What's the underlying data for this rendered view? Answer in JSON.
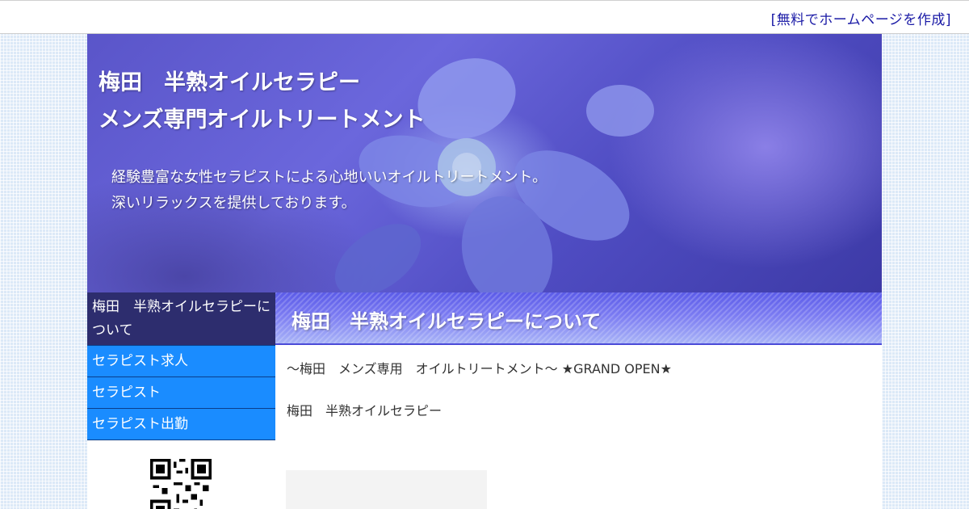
{
  "topbar": {
    "create_link": "[無料でホームページを作成]"
  },
  "header": {
    "title_line1": "梅田　半熟オイルセラピー",
    "title_line2": "メンズ専門オイルトリートメント",
    "desc_line1": "経験豊富な女性セラピストによる心地いいオイルトリートメント。",
    "desc_line2": "深いリラックスを提供しております。"
  },
  "sidebar": {
    "items": [
      {
        "label": "梅田　半熟オイルセラピーについて"
      },
      {
        "label": "セラピスト求人"
      },
      {
        "label": "セラピスト"
      },
      {
        "label": "セラピスト出勤"
      }
    ]
  },
  "main": {
    "heading": "梅田　半熟オイルセラピーについて",
    "lead": "〜梅田　メンズ専用　オイルトリートメント〜 ★GRAND OPEN★",
    "name": "梅田　半熟オイルセラピー"
  },
  "colors": {
    "nav_current": "#2d2d6e",
    "nav_link": "#1a8cff",
    "heading_blue": "#5b5be8",
    "topbar_link": "#1a1aa6"
  }
}
